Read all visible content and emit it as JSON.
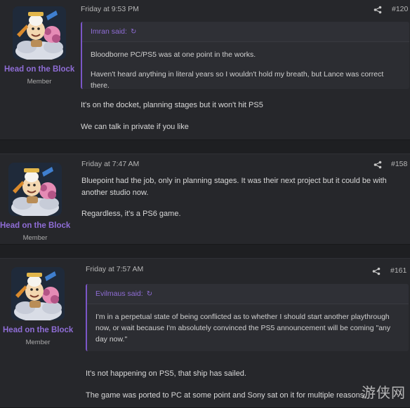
{
  "posts": [
    {
      "author": "Head on the Block",
      "role": "Member",
      "time": "Friday at 9:53 PM",
      "number": "#120",
      "quote": {
        "author": "Imran said:",
        "lines": [
          "Bloodborne PC/PS5 was at one point in the works.",
          "Haven't heard anything in literal years so I wouldn't hold my breath, but Lance was correct there."
        ]
      },
      "body": [
        "It's on the docket, planning stages but it won't hit PS5",
        "We can talk in private if you like"
      ]
    },
    {
      "author": "Head on the Block",
      "role": "Member",
      "time": "Friday at 7:47 AM",
      "number": "#158",
      "body": [
        "Bluepoint had the job, only in planning stages. It was their next project but it could be with another studio now.",
        "Regardless, it's a PS6 game."
      ]
    },
    {
      "author": "Head on the Block",
      "role": "Member",
      "time": "Friday at 7:57 AM",
      "number": "#161",
      "quote": {
        "author": "Evilmaus said:",
        "lines": [
          "I'm in a perpetual state of being conflicted as to whether I should start another playthrough now, or wait because I'm absolutely convinced the PS5 announcement will be coming \"any day now.\""
        ]
      },
      "body": [
        "It's not happening on PS5, that ship has sailed.",
        "The game was ported to PC at some point and Sony sat on it for multiple reasons."
      ]
    }
  ],
  "icons": {
    "share": "share-icon",
    "quote_arrow": "jump-to-quote-icon"
  },
  "colors": {
    "username": "#8f6dd6",
    "quote_border": "#7b56c8",
    "background": "#1e1f22",
    "post_bg": "#26272b"
  },
  "watermark": "游侠网"
}
